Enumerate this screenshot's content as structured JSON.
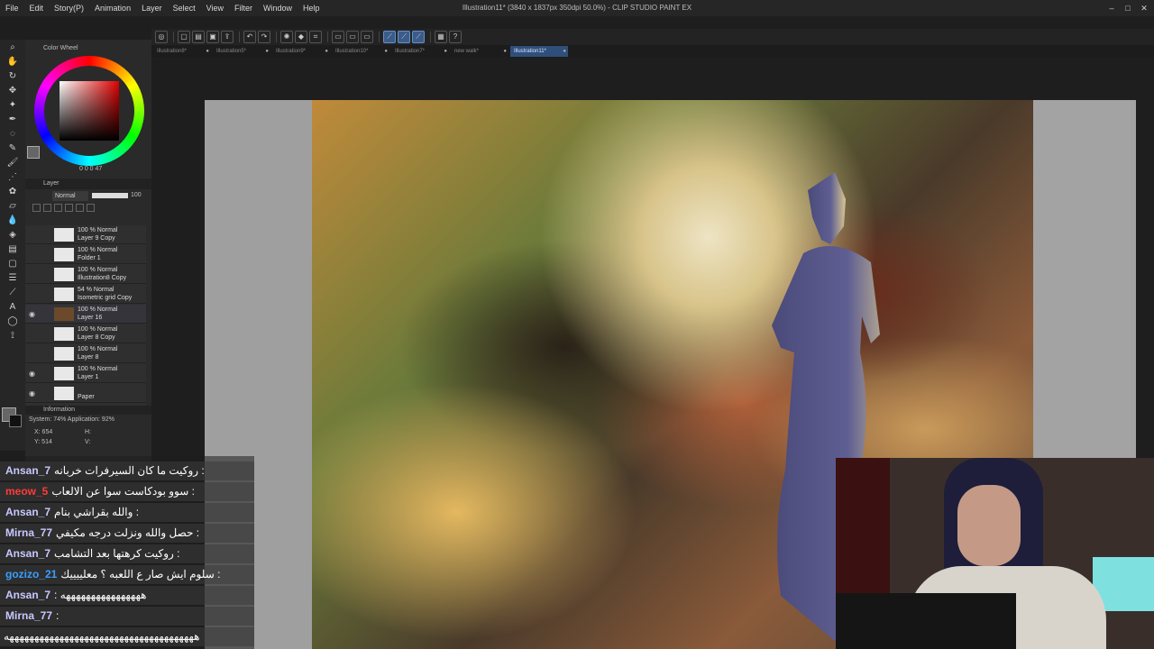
{
  "app": {
    "window_title": "Illustration11* (3840 x 1837px 350dpi 50.0%) - CLIP STUDIO PAINT EX",
    "menu": [
      "File",
      "Edit",
      "Story(P)",
      "Animation",
      "Layer",
      "Select",
      "View",
      "Filter",
      "Window",
      "Help"
    ]
  },
  "tabs": [
    {
      "label": "Illustration8*",
      "active": false
    },
    {
      "label": "Illustration5*",
      "active": false
    },
    {
      "label": "Illustration9*",
      "active": false
    },
    {
      "label": "Illustration10*",
      "active": false
    },
    {
      "label": "Illustration7*",
      "active": false
    },
    {
      "label": "new walk*",
      "active": false
    },
    {
      "label": "Illustration11*",
      "active": true
    }
  ],
  "color_wheel": {
    "title": "Color Wheel",
    "readout": "0  0  0  47"
  },
  "layer_panel": {
    "title": "Layer",
    "blend_mode": "Normal",
    "opacity": "100",
    "layers": [
      {
        "mode": "100 % Normal",
        "name": "Layer 9 Copy",
        "visible": false
      },
      {
        "mode": "100 % Normal",
        "name": "Folder 1",
        "visible": false
      },
      {
        "mode": "100 % Normal",
        "name": "Illustration8 Copy",
        "visible": false
      },
      {
        "mode": "54 % Normal",
        "name": "Isometric grid Copy",
        "visible": false
      },
      {
        "mode": "100 % Normal",
        "name": "Layer 16",
        "visible": true
      },
      {
        "mode": "100 % Normal",
        "name": "Layer 8 Copy",
        "visible": false
      },
      {
        "mode": "100 % Normal",
        "name": "Layer 8",
        "visible": false
      },
      {
        "mode": "100 % Normal",
        "name": "Layer 1",
        "visible": true
      },
      {
        "mode": "",
        "name": "Paper",
        "visible": true
      }
    ]
  },
  "info_panel": {
    "title": "Information",
    "system": "System: 74%  Application: 92%",
    "x": "X: 654",
    "y": "Y: 514",
    "h": "H:",
    "v": "V:"
  },
  "chat": [
    {
      "user": "Ansan_7",
      "color": "#c8c8ff",
      "message": "روكيت ما كان السيرفرات خربانه :"
    },
    {
      "user": "meow_5",
      "color": "#ff3b3b",
      "message": "سوو بودكاست سوا عن الالعاب :"
    },
    {
      "user": "Ansan_7",
      "color": "#c8c8ff",
      "message": "والله بقراشي بنام :"
    },
    {
      "user": "Mirna_77",
      "color": "#c8c8ff",
      "message": "حصل والله ونزلت درجه مكيفي :"
    },
    {
      "user": "Ansan_7",
      "color": "#c8c8ff",
      "message": "روكيت كرهتها بعد التشامب :"
    },
    {
      "user": "gozizo_21",
      "color": "#3aa0ff",
      "message": "سلوم ايش صار ع اللعبه ؟ معلييييك :"
    },
    {
      "user": "Ansan_7",
      "color": "#c8c8ff",
      "message": ": ههههههههههههههههه"
    },
    {
      "user": "Mirna_77",
      "color": "#c8c8ff",
      "message": ":"
    },
    {
      "user": "",
      "color": "#ffffff",
      "message": "ههههههههههههههههههههههههههههههههههههههه"
    }
  ],
  "colors": {
    "accent": "#3a5c8a",
    "tab_active": "#2f4f7a",
    "panel": "#2a2a2a"
  }
}
